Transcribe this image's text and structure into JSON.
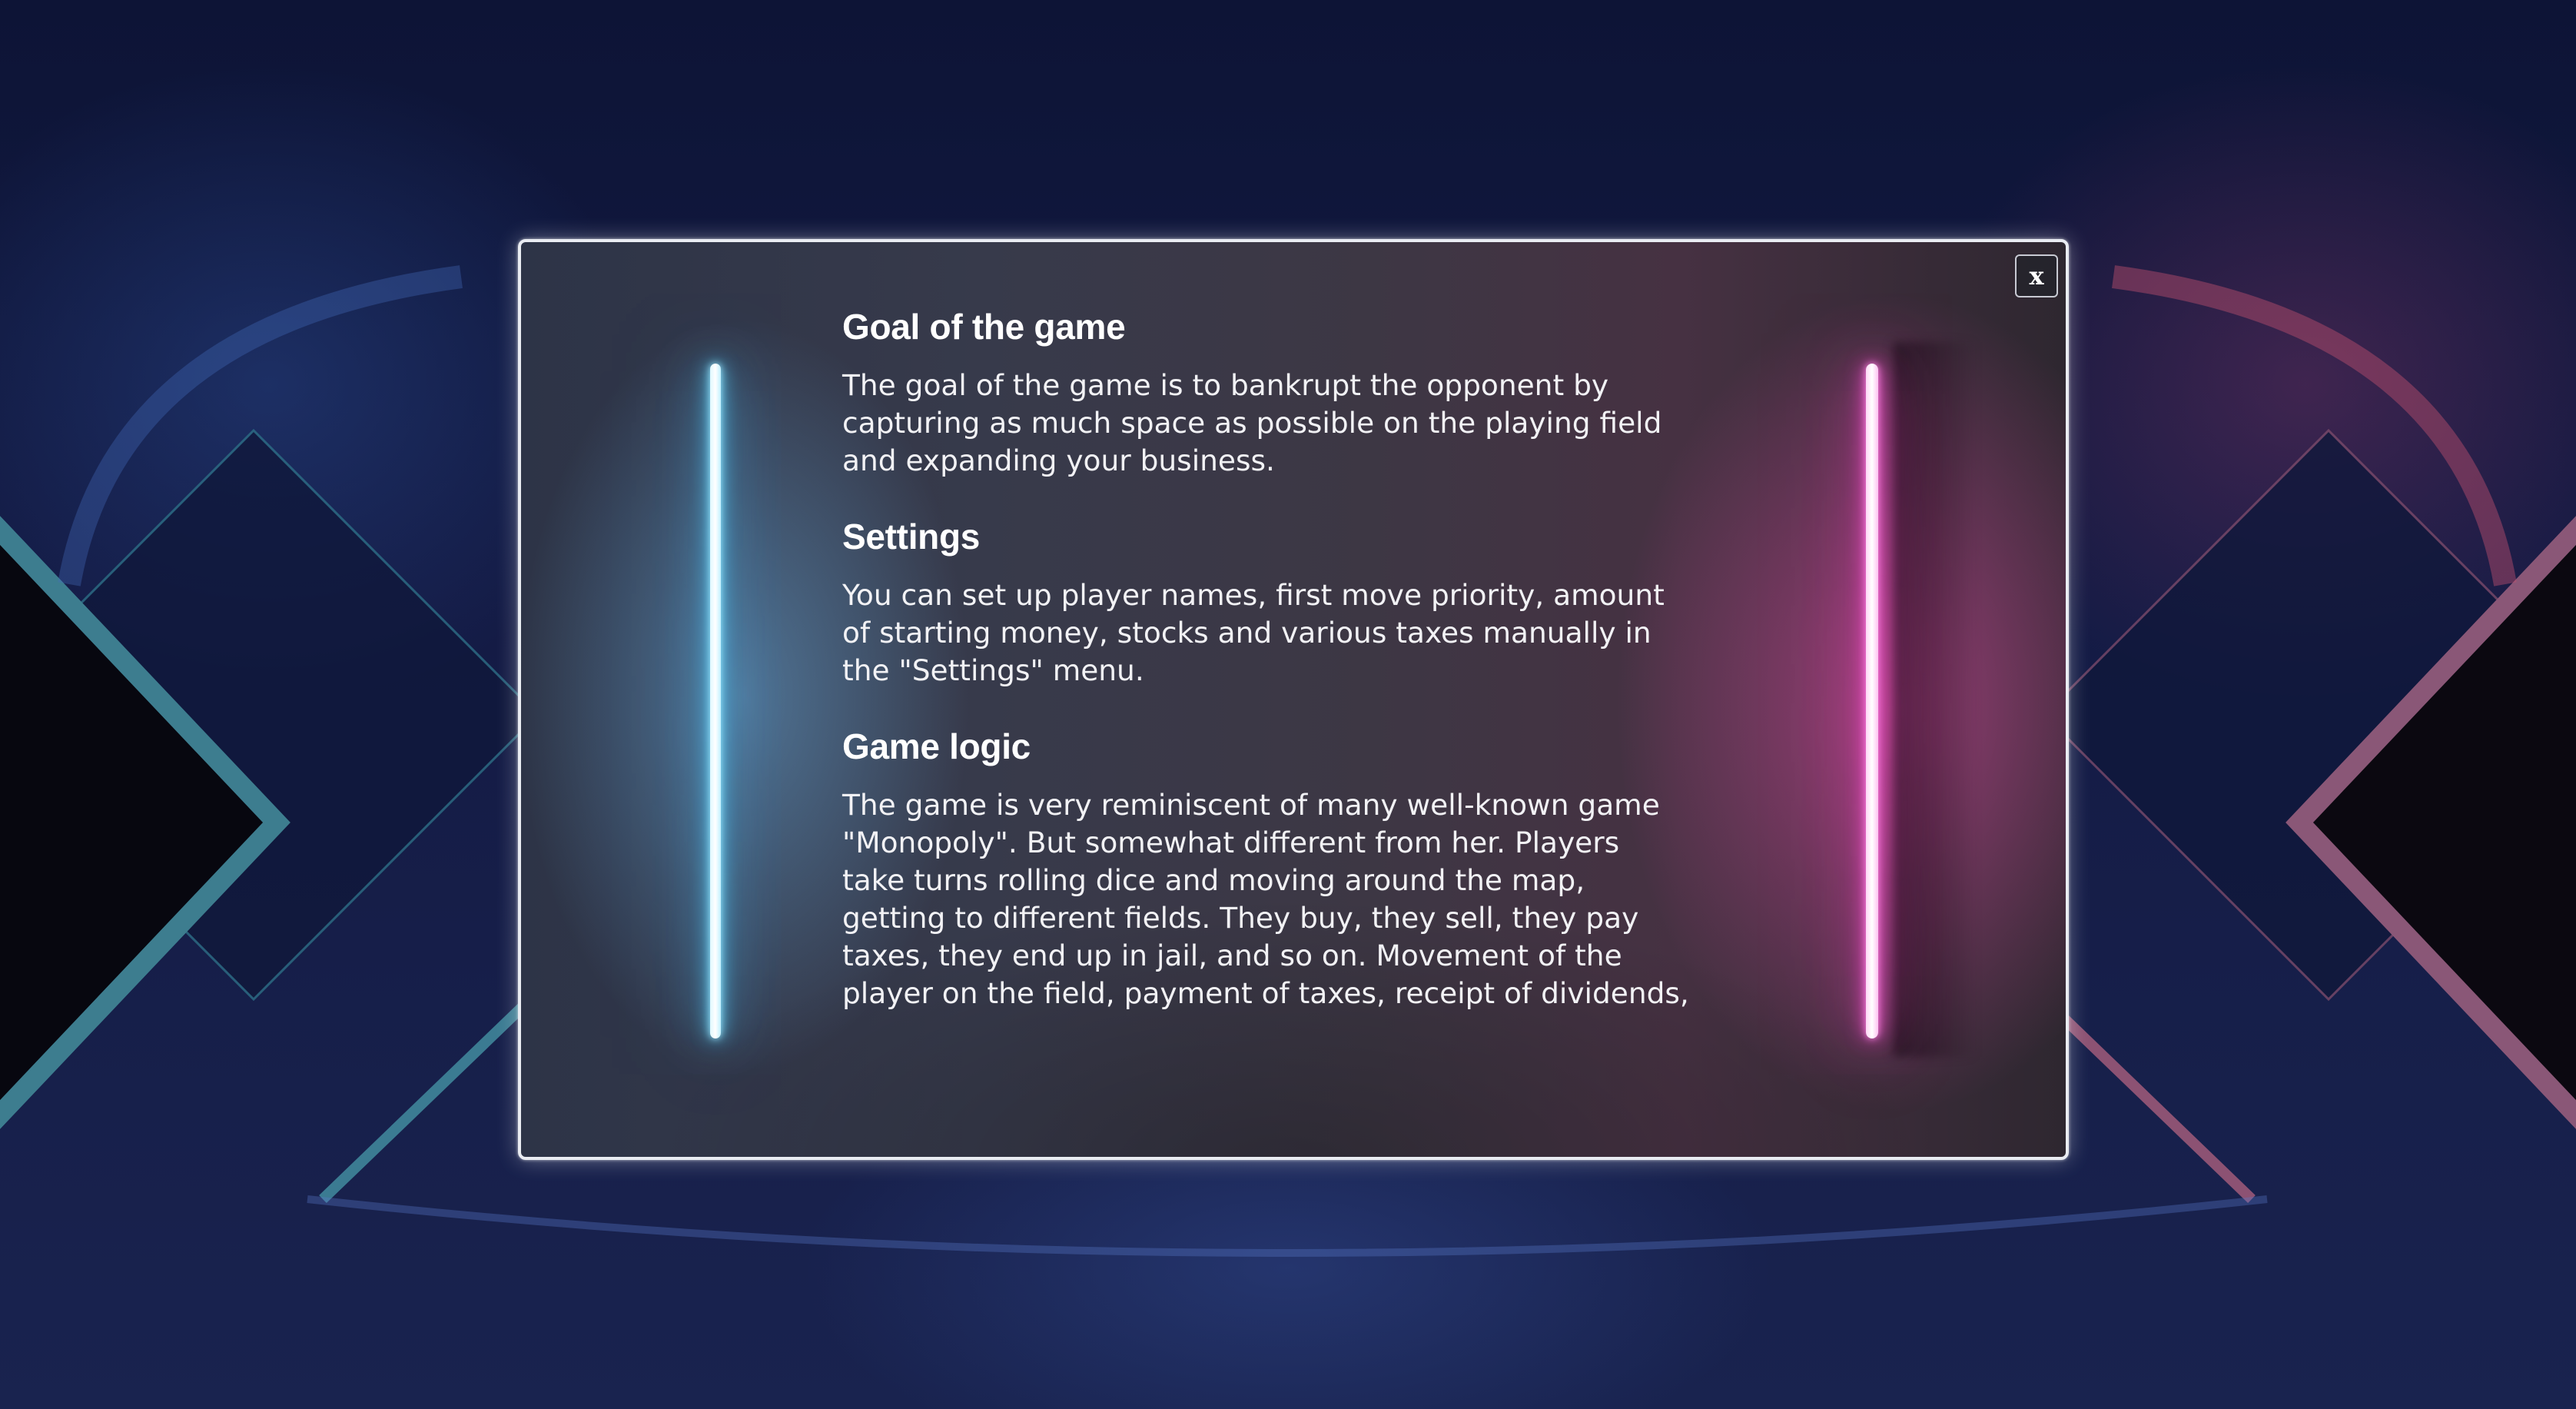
{
  "modal": {
    "close_label": "x",
    "sections": [
      {
        "title": "Goal of the game",
        "lines": [
          "The goal of the game is to bankrupt the opponent by",
          "capturing as much space as possible on the playing field",
          "and expanding your business."
        ]
      },
      {
        "title": "Settings",
        "lines": [
          "You can set up player names, first move priority, amount",
          "of starting money, stocks and various taxes manually in",
          "the \"Settings\" menu."
        ]
      },
      {
        "title": "Game logic",
        "lines": [
          "The game is very reminiscent of many well-known game",
          "\"Monopoly\". But somewhat different from her. Players",
          "take turns rolling dice and moving around the map,",
          "getting to different fields. They buy, they sell, they pay",
          "taxes, they end up in jail, and so on. Movement of the",
          "player on the field, payment of taxes, receipt of dividends,"
        ]
      }
    ]
  },
  "colors": {
    "neon_left": "#54d2ff",
    "neon_right": "#ff4fd6",
    "background": "#141b45"
  }
}
